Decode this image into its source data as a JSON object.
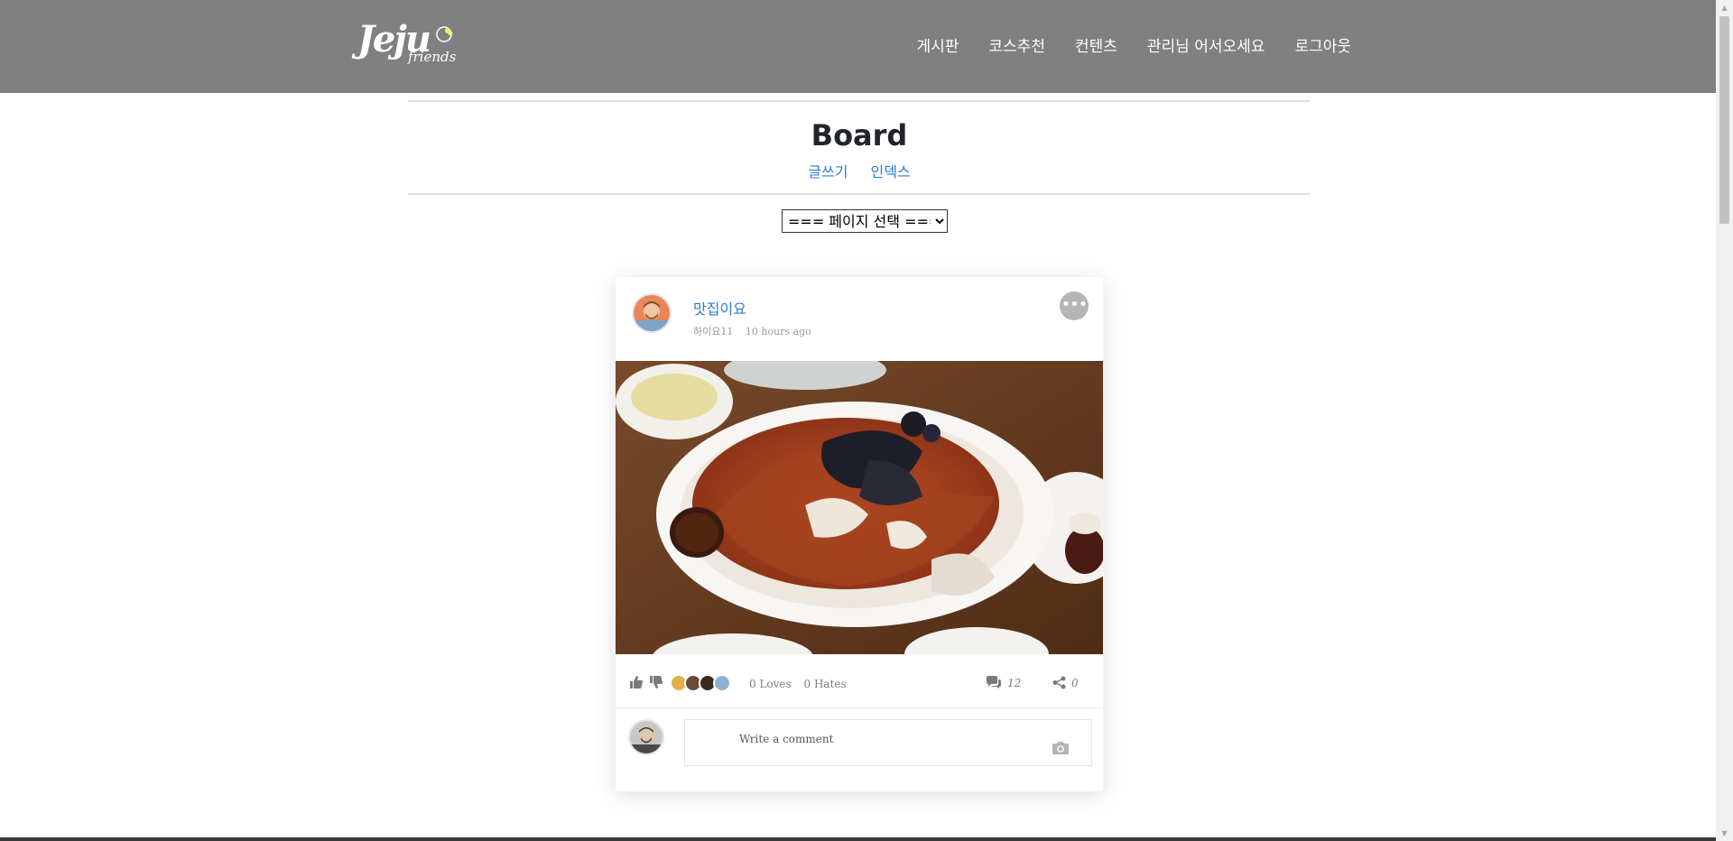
{
  "navbar": {
    "logo_main": "Jeju",
    "logo_sub": "friends",
    "items": [
      {
        "label": "게시판"
      },
      {
        "label": "코스추천"
      },
      {
        "label": "컨텐츠"
      },
      {
        "label": "관리님 어서오세요"
      },
      {
        "label": "로그아웃"
      }
    ]
  },
  "board": {
    "title": "Board",
    "links": [
      {
        "label": "글쓰기"
      },
      {
        "label": "인덱스"
      }
    ]
  },
  "page_select": {
    "selected": "=== 페이지 선택 ==="
  },
  "post": {
    "title": "맛집이요",
    "author": "하이요11",
    "time": "10 hours ago",
    "more_icon": "ellipsis-icon",
    "loves": "0 Loves",
    "hates": "0 Hates",
    "comments_count": "12",
    "shares_count": "0",
    "comment_placeholder": "Write a comment"
  },
  "colors": {
    "navbar_bg": "#808080",
    "link_blue": "#2b7ad9"
  }
}
